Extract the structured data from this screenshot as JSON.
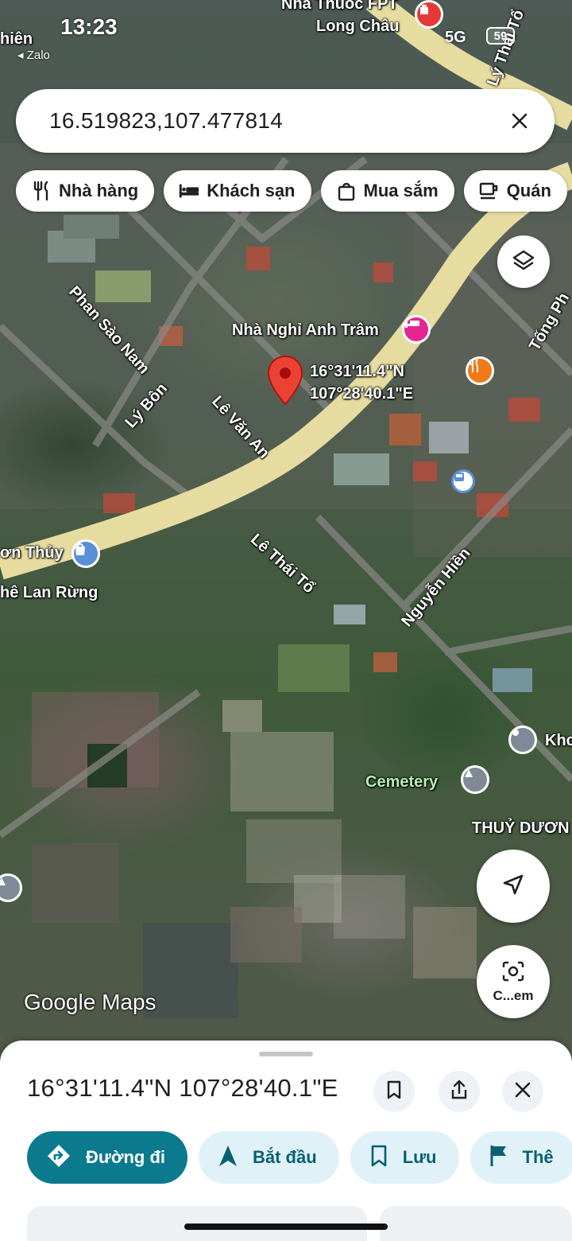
{
  "status": {
    "time": "13:23",
    "back_app": "◂ Zalo",
    "network": "5G",
    "battery": "59"
  },
  "search": {
    "query": "16.519823,107.477814"
  },
  "chips": [
    {
      "label": "Nhà hàng",
      "icon": "restaurant-icon"
    },
    {
      "label": "Khách sạn",
      "icon": "hotel-icon"
    },
    {
      "label": "Mua sắm",
      "icon": "shopping-bag-icon"
    },
    {
      "label": "Quán",
      "icon": "coffee-icon"
    }
  ],
  "map": {
    "labels": {
      "top_left": "hiên",
      "store_line1": "Nhà Thuốc FPT",
      "store_line2": "Long Châu",
      "ly_thai_to_top": "Lý Thái Tổ",
      "phan_sao_nam": "Phan Sào Nam",
      "ly_bon": "Lý Bôn",
      "le_van_an": "Lê Văn An",
      "hotel": "Nhà Nghỉ Anh Trâm",
      "tong_phuoc": "Tống Ph",
      "coord_lat": "16°31'11.4\"N",
      "coord_lng": "107°28'40.1\"E",
      "son_thuy": "ơn Thủy",
      "che_lan_rung": "hê Lan Rừng",
      "le_thai_to": "Lê Thái Tổ",
      "nguyen_hien": "Nguyễn Hiền",
      "cemetery": "Cemetery",
      "kho": "Khc",
      "thuy_duong": "THUỶ DƯƠN"
    },
    "brand": "Google Maps",
    "camera_label": "C...em"
  },
  "sheet": {
    "title": "16°31'11.4\"N 107°28'40.1\"E",
    "actions": [
      {
        "label": "Đường đi",
        "icon": "directions-icon"
      },
      {
        "label": "Bắt đầu",
        "icon": "navigation-arrow-icon"
      },
      {
        "label": "Lưu",
        "icon": "bookmark-icon"
      },
      {
        "label": "Thê",
        "icon": "flag-icon"
      }
    ]
  },
  "colors": {
    "accent": "#0b7a8f",
    "pin": "#ea4335",
    "road": "#e6dca0",
    "hotel_poi": "#e52592",
    "food_poi": "#f07a17",
    "transit_poi": "#5a8fd8"
  }
}
